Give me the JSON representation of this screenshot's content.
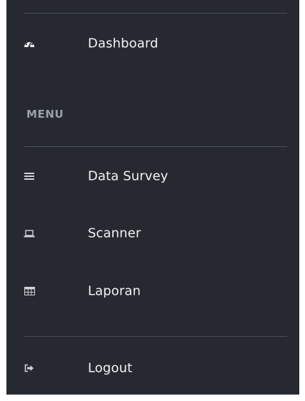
{
  "sidebar": {
    "dashboard": {
      "label": "Dashboard",
      "icon": "dashboard-gauge-icon"
    },
    "menu_heading": "MENU",
    "items": [
      {
        "label": "Data Survey",
        "icon": "list-lines-icon"
      },
      {
        "label": "Scanner",
        "icon": "laptop-icon"
      },
      {
        "label": "Laporan",
        "icon": "table-grid-icon"
      }
    ],
    "logout": {
      "label": "Logout",
      "icon": "sign-out-icon"
    }
  },
  "colors": {
    "sidebar_bg": "#262a30",
    "text": "#f1f3f5",
    "heading": "#9aa0a8",
    "divider": "#4a4f57"
  }
}
